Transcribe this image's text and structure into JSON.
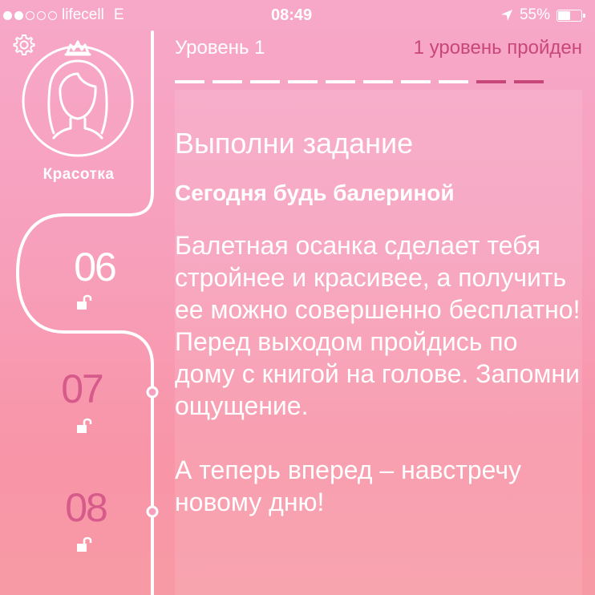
{
  "status_bar": {
    "carrier": "lifecell",
    "network": "E",
    "time": "08:49",
    "battery": "55%",
    "battery_level": 0.55,
    "signal_bars_filled": 2,
    "signal_bars_total": 5
  },
  "sidebar": {
    "avatar_name": "Красотка",
    "levels": [
      {
        "number": "06",
        "state": "active"
      },
      {
        "number": "07",
        "state": "locked"
      },
      {
        "number": "08",
        "state": "locked"
      }
    ]
  },
  "header": {
    "level_label": "Уровень 1",
    "level_status": "1 уровень пройден",
    "progress_total": 10,
    "progress_highlighted": [
      9,
      10
    ]
  },
  "task": {
    "title": "Выполни задание",
    "subtitle": "Сегодня будь балериной",
    "paragraph1": "Балетная осанка сделает тебя стройнее и красивее, а получить ее можно совершенно бесплатно! Перед выходом пройдись по дому с книгой на голове. Запомни ощущение.",
    "paragraph2": "А теперь вперед – навстречу новому дню!"
  },
  "colors": {
    "accent": "#c8477b",
    "locked_number": "#d65a8a",
    "foreground": "#ffffff"
  }
}
